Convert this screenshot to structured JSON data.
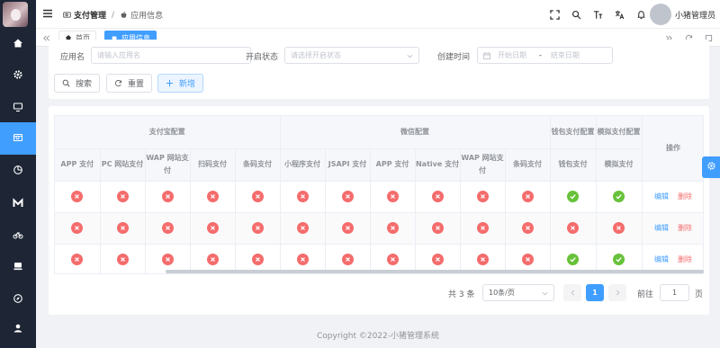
{
  "sidebar": {
    "items": [
      {
        "icon": "home-icon",
        "active": false
      },
      {
        "icon": "gear-icon",
        "active": false
      },
      {
        "icon": "monitor-icon",
        "active": false
      },
      {
        "icon": "payment-icon",
        "active": true
      },
      {
        "icon": "pie-chart-icon",
        "active": false
      },
      {
        "icon": "m-logo-icon",
        "active": false
      },
      {
        "icon": "bicycle-icon",
        "active": false
      },
      {
        "icon": "stamp-icon",
        "active": false
      },
      {
        "icon": "compass-icon",
        "active": false
      },
      {
        "icon": "user-icon",
        "active": false
      }
    ]
  },
  "header": {
    "breadcrumb_parent": "支付管理",
    "breadcrumb_sep": "/",
    "breadcrumb_current": "应用信息",
    "username": "小猪管理员"
  },
  "tabs": [
    {
      "label": "首页",
      "icon": "home-icon",
      "active": false
    },
    {
      "label": "应用信息",
      "icon": "apple-icon",
      "active": true
    }
  ],
  "search": {
    "app_name_label": "应用名",
    "app_name_placeholder": "请输入应用名",
    "status_label": "开启状态",
    "status_placeholder": "请选择开启状态",
    "created_label": "创建时间",
    "start_placeholder": "开始日期",
    "range_sep": "-",
    "end_placeholder": "结束日期",
    "search_btn": "搜索",
    "reset_btn": "重置",
    "add_btn": "新增"
  },
  "table": {
    "group_alipay": "支付宝配置",
    "group_wechat": "微信配置",
    "wallet_header": "钱包支付配置",
    "mock_header": "模拟支付配置",
    "op_header": "操作",
    "columns": [
      "APP 支付",
      "PC 网站支付",
      "WAP 网站支付",
      "扫码支付",
      "条码支付",
      "小程序支付",
      "JSAPI 支付",
      "APP 支付",
      "Native 支付",
      "WAP 网站支付",
      "条码支付",
      "钱包支付",
      "模拟支付"
    ],
    "rows": [
      {
        "status": [
          false,
          false,
          false,
          false,
          false,
          false,
          false,
          false,
          false,
          false,
          false,
          true,
          true
        ],
        "edit": "编辑",
        "delete": "删除"
      },
      {
        "status": [
          false,
          false,
          false,
          false,
          false,
          false,
          false,
          false,
          false,
          false,
          false,
          false,
          false
        ],
        "edit": "编辑",
        "delete": "删除"
      },
      {
        "status": [
          false,
          false,
          false,
          false,
          false,
          false,
          false,
          false,
          false,
          false,
          false,
          true,
          true
        ],
        "edit": "编辑",
        "delete": "删除"
      }
    ]
  },
  "pagination": {
    "total_text": "共 3 条",
    "page_size": "10条/页",
    "current_page": "1",
    "goto_label": "前往",
    "goto_value": "1",
    "page_unit": "页"
  },
  "footer": {
    "text": "Copyright ©2022-小猪管理系统"
  },
  "colors": {
    "primary": "#409eff",
    "success": "#67c23a",
    "danger": "#f56c6c",
    "sidebar": "#1e2635"
  }
}
